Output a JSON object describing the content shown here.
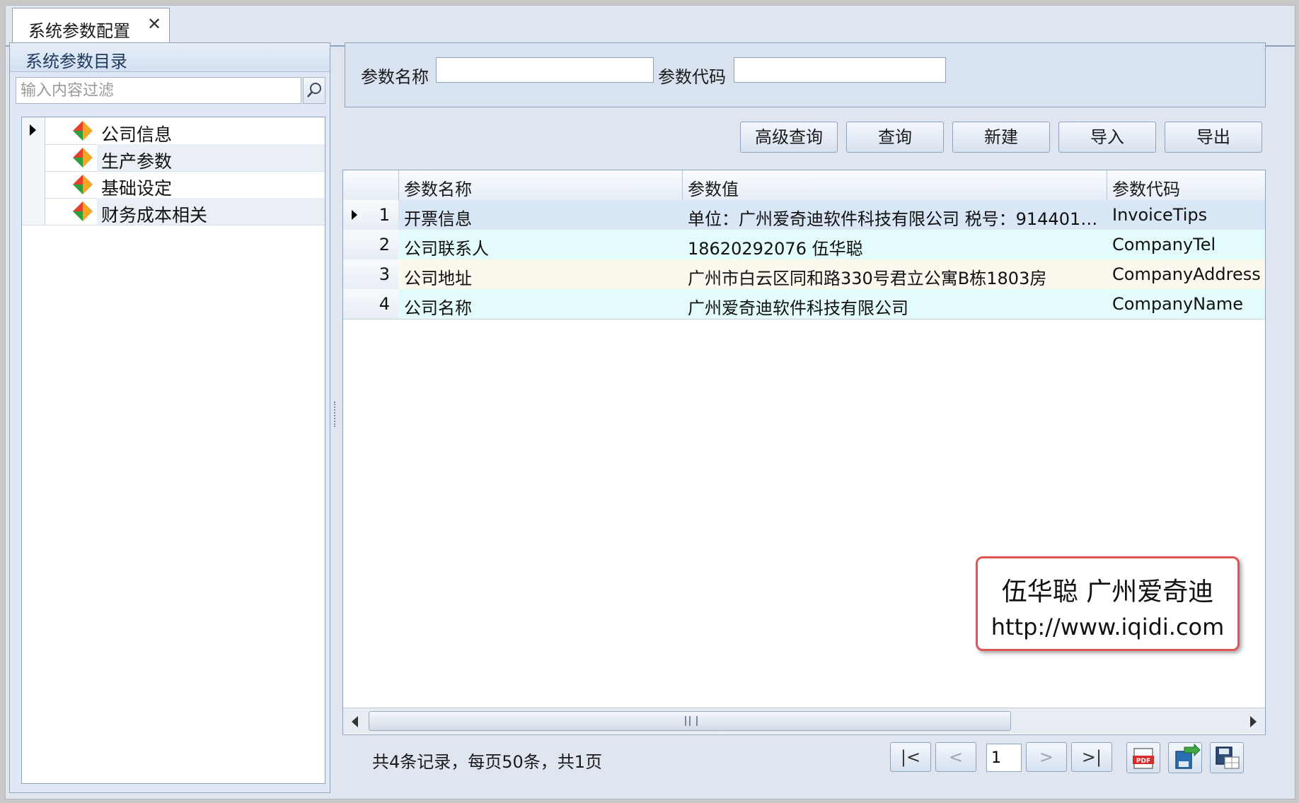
{
  "tab": {
    "title": "系统参数配置",
    "close": "✕"
  },
  "left": {
    "title": "系统参数目录",
    "filter_placeholder": "输入内容过滤",
    "tree": [
      {
        "label": "公司信息"
      },
      {
        "label": "生产参数"
      },
      {
        "label": "基础设定"
      },
      {
        "label": "财务成本相关"
      }
    ]
  },
  "search": {
    "name_label": "参数名称",
    "name_value": "",
    "code_label": "参数代码",
    "code_value": ""
  },
  "toolbar": {
    "advanced_label": "高级查询",
    "query_label": "查询",
    "new_label": "新建",
    "import_label": "导入",
    "export_label": "导出"
  },
  "grid": {
    "columns": [
      "参数名称",
      "参数值",
      "参数代码"
    ],
    "rows": [
      {
        "no": "1",
        "name": "开票信息",
        "value": "单位：广州爱奇迪软件科技有限公司 税号：914401…",
        "code": "InvoiceTips"
      },
      {
        "no": "2",
        "name": "公司联系人",
        "value": "18620292076 伍华聪",
        "code": "CompanyTel"
      },
      {
        "no": "3",
        "name": "公司地址",
        "value": "广州市白云区同和路330号君立公寓B栋1803房",
        "code": "CompanyAddress"
      },
      {
        "no": "4",
        "name": "公司名称",
        "value": "广州爱奇迪软件科技有限公司",
        "code": "CompanyName"
      }
    ],
    "row_colors": [
      "#d9e6f6",
      "#e4fbfb",
      "#fbf8ee",
      "#e4fbfb"
    ]
  },
  "watermark": {
    "line1": "伍华聪 广州爱奇迪",
    "line2": "http://www.iqidi.com"
  },
  "pager": {
    "summary": "共4条记录，每页50条，共1页",
    "first": "|<",
    "prev": "<",
    "page": "1",
    "next": ">",
    "last": ">|"
  }
}
